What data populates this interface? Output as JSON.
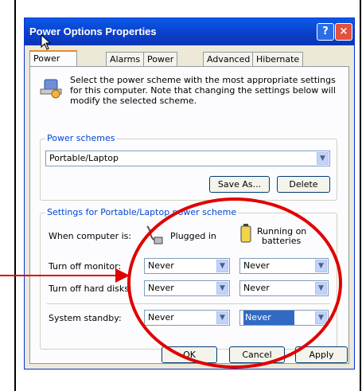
{
  "window": {
    "title": "Power Options Properties",
    "help_glyph": "?",
    "close_glyph": "×"
  },
  "tabs": [
    "Power Schemes",
    "Alarms",
    "Power Meter",
    "Advanced",
    "Hibernate"
  ],
  "description": "Select the power scheme with the most appropriate settings for this computer. Note that changing the settings below will modify the selected scheme.",
  "power_schemes": {
    "group_label": "Power schemes",
    "selected": "Portable/Laptop",
    "save_as_label": "Save As...",
    "delete_label": "Delete"
  },
  "settings": {
    "group_label": "Settings for Portable/Laptop power scheme",
    "when_label": "When computer is:",
    "plugged_label": "Plugged in",
    "battery_label_line1": "Running on",
    "battery_label_line2": "batteries",
    "rows": [
      {
        "label": "Turn off monitor:",
        "plugged": "Never",
        "battery": "Never"
      },
      {
        "label": "Turn off hard disks:",
        "plugged": "Never",
        "battery": "Never"
      },
      {
        "label": "System standby:",
        "plugged": "Never",
        "battery": "Never"
      }
    ]
  },
  "buttons": {
    "ok": "OK",
    "cancel": "Cancel",
    "apply": "Apply"
  },
  "colors": {
    "annotation": "#e00000",
    "titlebar": "#0a5ae8"
  }
}
